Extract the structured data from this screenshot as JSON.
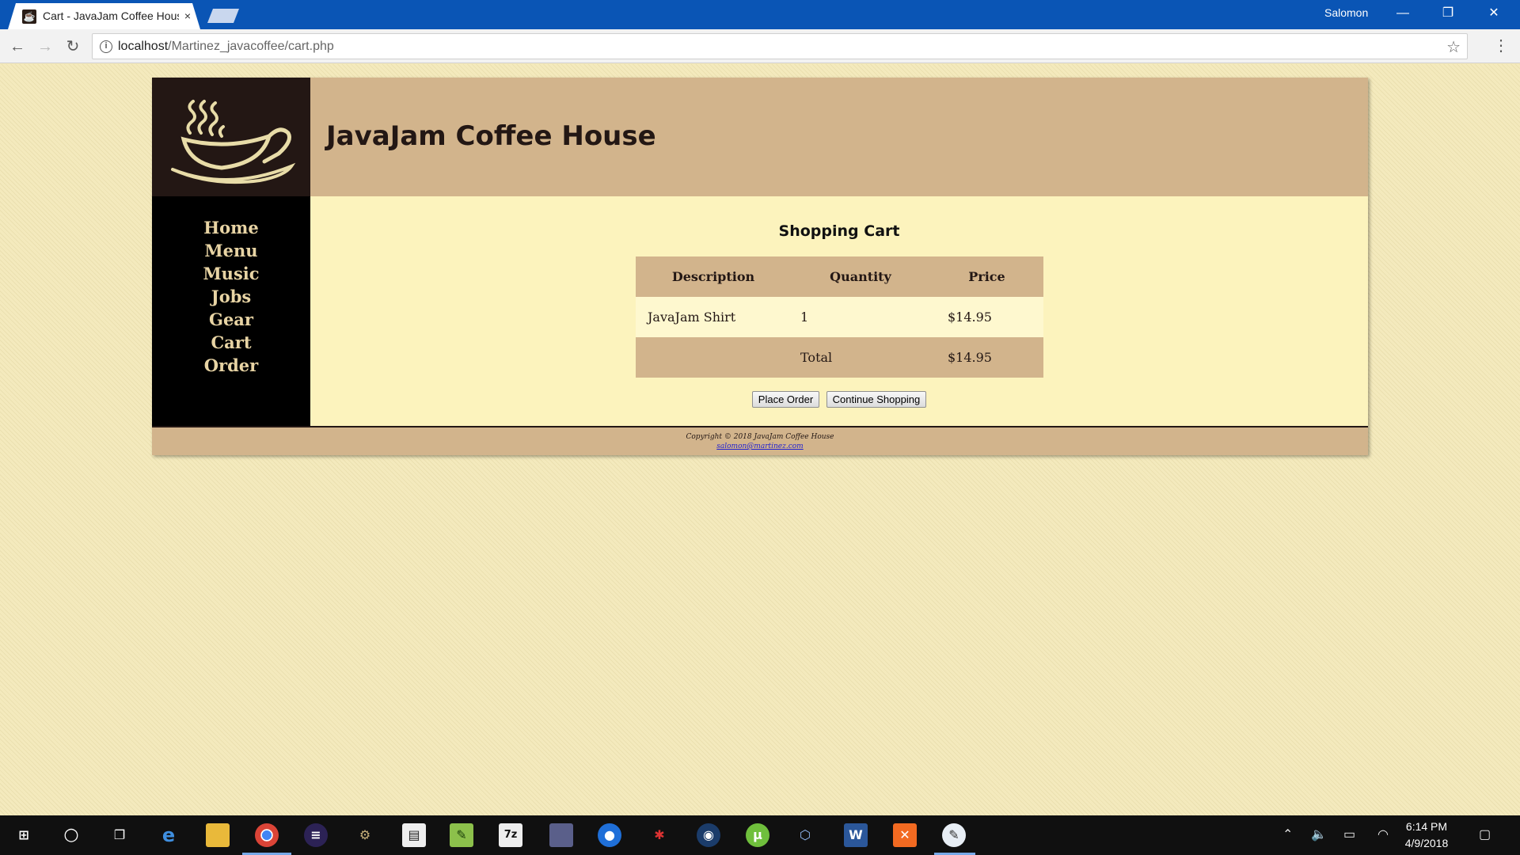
{
  "browser": {
    "tab_title": "Cart - JavaJam Coffee House",
    "tab_close": "×",
    "user_name": "Salomon",
    "window_buttons": {
      "minimize": "—",
      "restore": "❐",
      "close": "✕"
    },
    "url_host": "localhost",
    "url_path": "/Martinez_javacoffee/cart.php"
  },
  "site": {
    "title": "JavaJam Coffee House",
    "nav": [
      "Home",
      "Menu",
      "Music",
      "Jobs",
      "Gear",
      "Cart",
      "Order"
    ]
  },
  "cart": {
    "heading": "Shopping Cart",
    "columns": [
      "Description",
      "Quantity",
      "Price"
    ],
    "items": [
      {
        "description": "JavaJam Shirt",
        "quantity": "1",
        "price": "$14.95"
      }
    ],
    "total_label": "Total",
    "total_value": "$14.95",
    "place_order": "Place Order",
    "continue_shopping": "Continue Shopping"
  },
  "footer": {
    "copyright": "Copyright © 2018 JavaJam Coffee House",
    "email": "salomon@martinez.com"
  },
  "taskbar": {
    "icons": [
      "windows-start",
      "cortana-search",
      "task-view",
      "edge",
      "file-explorer",
      "chrome",
      "eclipse",
      "blender",
      "movie-maker",
      "notepad-plus",
      "7zip",
      "virtual-machine",
      "maps",
      "spider-app",
      "steam",
      "utorrent",
      "virtualbox",
      "word",
      "xampp",
      "paint"
    ],
    "time": "6:14 PM",
    "date": "4/9/2018"
  },
  "colors": {
    "header_tan": "#d2b48c",
    "dark_brown": "#231714",
    "content_cream": "#fcf3bd",
    "chrome_blue": "#0a55b5"
  }
}
